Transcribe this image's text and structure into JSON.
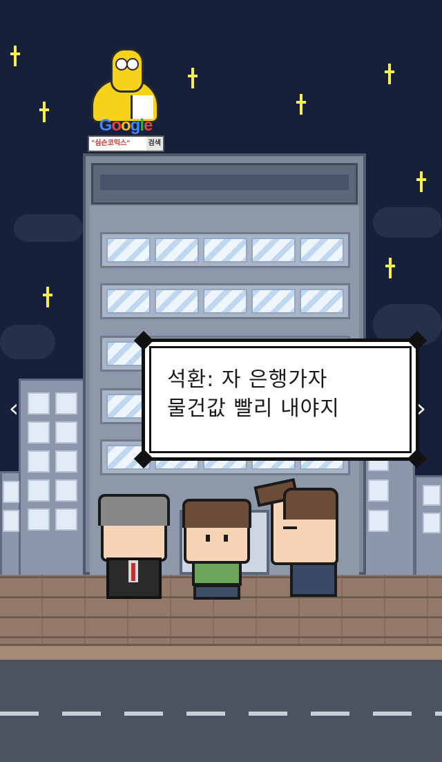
{
  "game": {
    "dialog": {
      "speaker": "석환:",
      "line1": "자 은행가자",
      "line2": "물건값 빨리 내야지"
    },
    "billboard": {
      "logo": "Google",
      "query": "\"심슨코믹스\"",
      "button": "검색"
    },
    "navigation": {
      "prev": "‹",
      "next": "›"
    }
  }
}
